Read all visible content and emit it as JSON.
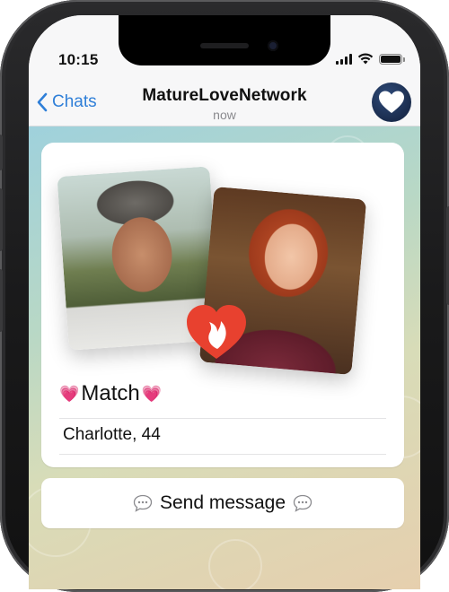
{
  "status_bar": {
    "time": "10:15"
  },
  "header": {
    "back_label": "Chats",
    "title": "MatureLoveNetwork",
    "subtitle": "now"
  },
  "match_card": {
    "label": "Match",
    "profile": "Charlotte, 44"
  },
  "action": {
    "label": "Send message"
  },
  "colors": {
    "accent_blue": "#2f7fd8",
    "heart_red": "#e8412f",
    "avatar_navy": "#1a2c4d",
    "match_heart_pink": "#ff4fa3"
  },
  "icons": {
    "back": "chevron-left-icon",
    "avatar": "heart-icon",
    "match_badge": "heart-flame-icon",
    "match_emoji": "growing-heart-icon",
    "message": "speech-bubble-icon"
  }
}
